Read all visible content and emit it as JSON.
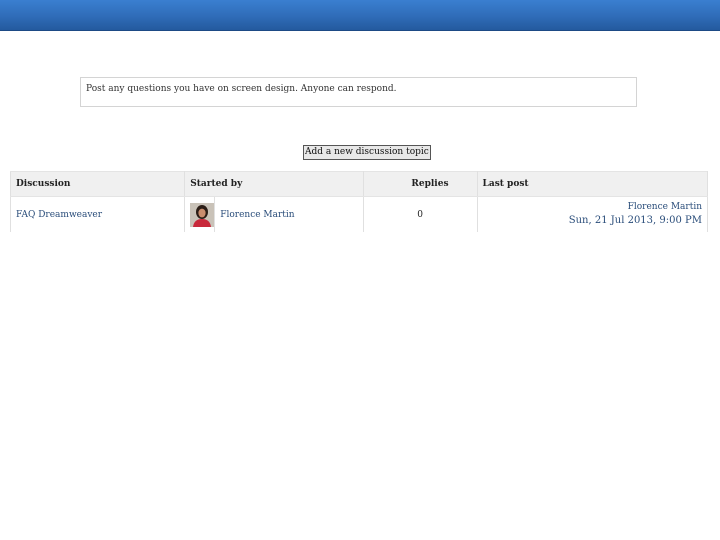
{
  "forum": {
    "intro_text": "Post any questions you have on screen design. Anyone can respond.",
    "add_topic_label": "Add a new discussion topic"
  },
  "table": {
    "headers": {
      "discussion": "Discussion",
      "started_by": "Started by",
      "replies": "Replies",
      "last_post": "Last post"
    },
    "rows": [
      {
        "discussion": "FAQ Dreamweaver",
        "started_by": "Florence Martin",
        "replies": "0",
        "last_post_author": "Florence Martin",
        "last_post_date": "Sun, 21 Jul 2013, 9:00 PM"
      }
    ]
  },
  "colors": {
    "topbar": "#2f6cb8",
    "link": "#2a4d7a",
    "header_bg": "#f0f0f0"
  }
}
